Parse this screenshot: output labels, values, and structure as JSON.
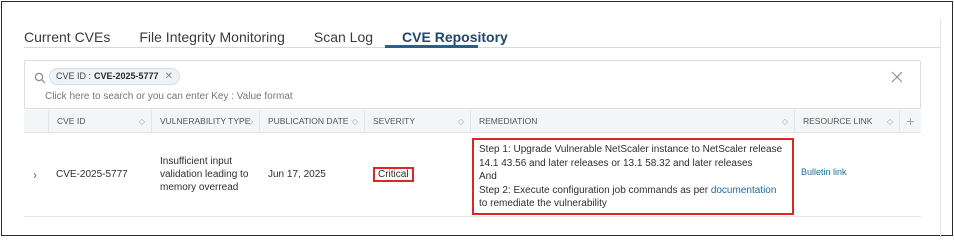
{
  "tabs": [
    {
      "label": "Current CVEs"
    },
    {
      "label": "File Integrity Monitoring"
    },
    {
      "label": "Scan Log"
    },
    {
      "label": "CVE Repository"
    }
  ],
  "search": {
    "chip_key": "CVE ID :",
    "chip_value": "CVE-2025-5777",
    "placeholder": "Click here to search or you can enter Key : Value format"
  },
  "table": {
    "headers": [
      "CVE ID",
      "VULNERABILITY TYPE",
      "PUBLICATION DATE",
      "SEVERITY",
      "REMEDIATION",
      "RESOURCE LINK"
    ],
    "row": {
      "cve_id": "CVE-2025-5777",
      "vuln_type_line1": "Insufficient input",
      "vuln_type_line2": "validation leading to",
      "vuln_type_line3": "memory overread",
      "publication_date": "Jun 17, 2025",
      "severity": "Critical",
      "remediation_line1": "Step 1: Upgrade Vulnerable NetScaler instance to NetScaler release",
      "remediation_line2": "14.1 43.56 and later releases or 13.1 58.32 and later releases",
      "remediation_line3": "And",
      "remediation_line4_prefix": "Step 2: Execute configuration job commands as per",
      "remediation_link": "documentation",
      "remediation_line5": "to remediate the vulnerability",
      "resource_link": "Bulletin link"
    }
  },
  "colors": {
    "active_tab": "#21486b",
    "highlight_box": "#d92626",
    "link": "#1a6aa2"
  }
}
